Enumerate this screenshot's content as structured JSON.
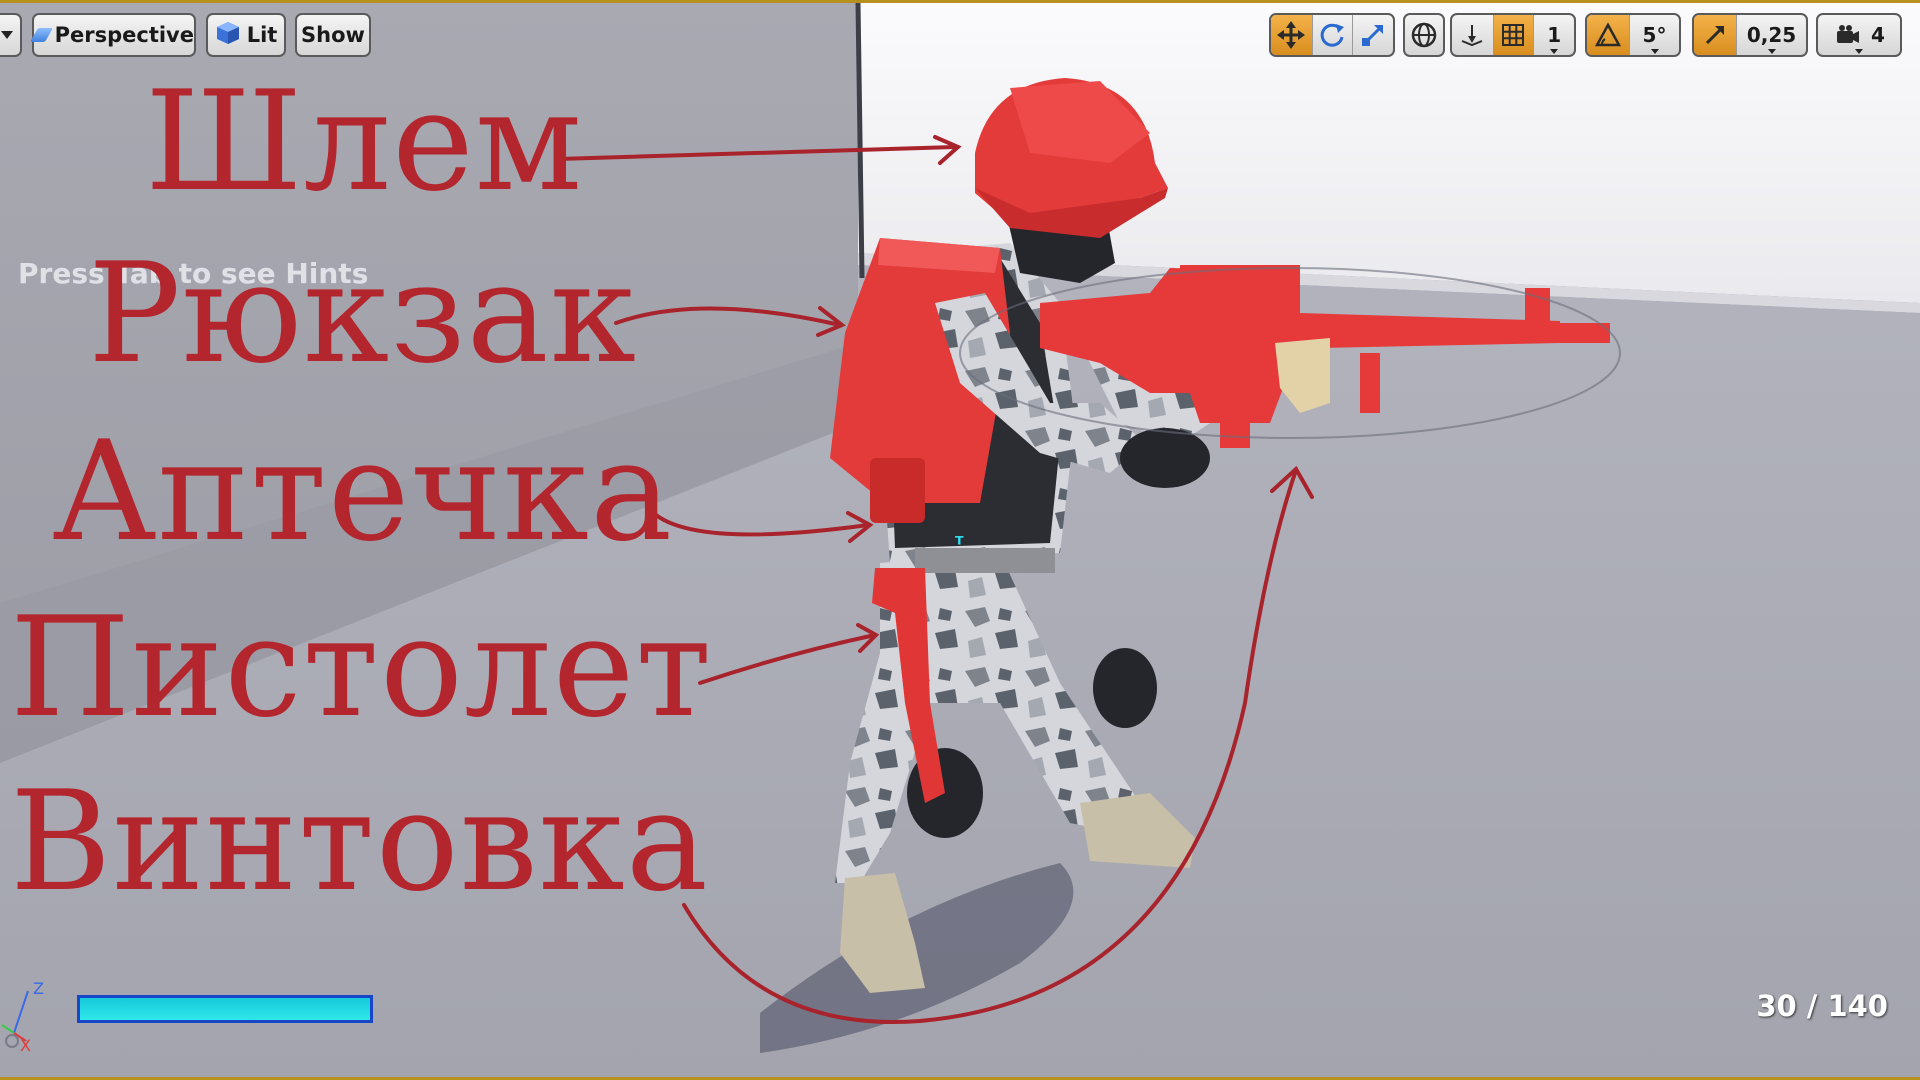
{
  "toolbar": {
    "perspective_label": "Perspective",
    "lit_label": "Lit",
    "show_label": "Show",
    "rotation_snap_value": "5°",
    "grid_snap_value": "1",
    "scale_snap_value": "0,25",
    "camera_speed_value": "4",
    "transform_tools": [
      "translate-icon",
      "rotate-icon",
      "scale-icon"
    ],
    "active_color": "#e89a2a"
  },
  "hint": "Press Tab to see Hints",
  "annotations": {
    "helmet": "Шлем",
    "backpack": "Рюкзак",
    "medkit": "Аптечка",
    "pistol": "Пистолет",
    "rifle": "Винтовка",
    "color": "#b3262e"
  },
  "hud": {
    "ammo": "30 / 140",
    "stat_bar_fraction": 1.0,
    "stat_bar_color": "#1ad6e2"
  },
  "axis": {
    "z": "Z",
    "x": "X"
  }
}
